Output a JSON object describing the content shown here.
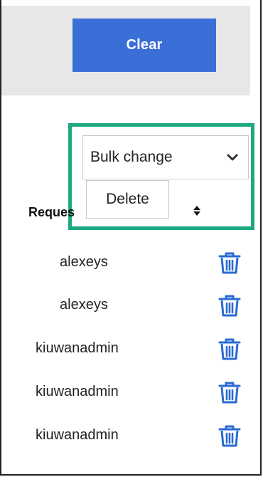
{
  "toolbar": {
    "clear_label": "Clear"
  },
  "bulk_change": {
    "selected": "Bulk change",
    "menu_items": [
      "Delete"
    ]
  },
  "table": {
    "header_label": "Reques",
    "rows": [
      {
        "user": "alexeys"
      },
      {
        "user": "alexeys"
      },
      {
        "user": "kiuwanadmin"
      },
      {
        "user": "kiuwanadmin"
      },
      {
        "user": "kiuwanadmin"
      }
    ]
  },
  "colors": {
    "accent_blue": "#3b6fd8",
    "highlight_green": "#1da882",
    "trash_blue": "#2a6ad3"
  },
  "icons": {
    "trash": "trash-icon",
    "sort": "sort-icon",
    "chevron": "chevron-down-icon"
  }
}
